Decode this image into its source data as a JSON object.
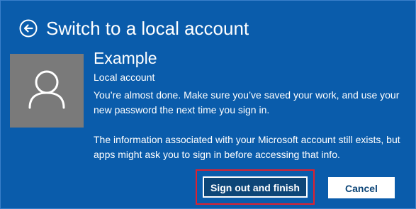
{
  "header": {
    "back_icon": "back-arrow-icon",
    "title": "Switch to a local account"
  },
  "account": {
    "avatar_icon": "user-avatar-icon",
    "username": "Example",
    "type": "Local account"
  },
  "messages": [
    "You’re almost done. Make sure you’ve saved your work, and use your new password the next time you sign in.",
    "The information associated with your Microsoft account still exists, but apps might ask you to sign in before accessing that info."
  ],
  "buttons": {
    "primary_label": "Sign out and finish",
    "secondary_label": "Cancel"
  },
  "colors": {
    "background": "#0a5cab",
    "avatar_background": "#7a7a7a",
    "primary_button": "#0d4678",
    "highlight_border": "#e0202e"
  }
}
